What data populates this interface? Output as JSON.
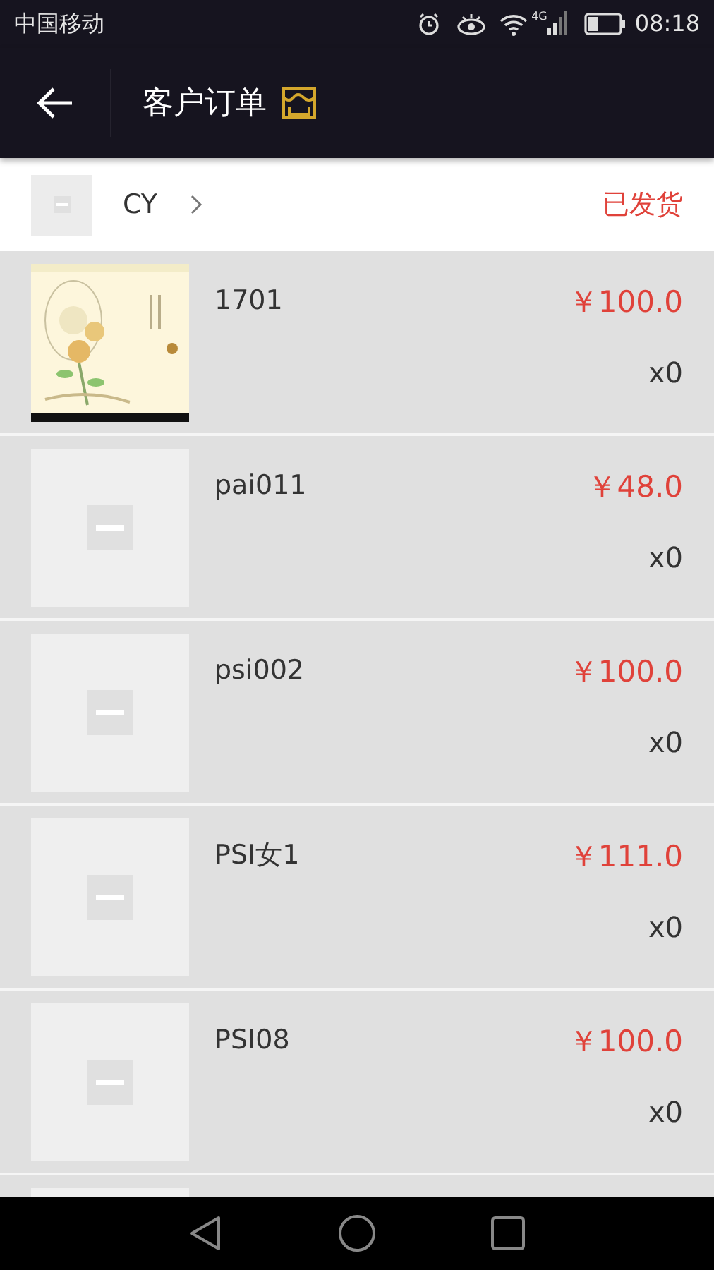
{
  "status_bar": {
    "carrier": "中国移动",
    "network": "4G",
    "time": "08:18"
  },
  "header": {
    "title": "客户订单"
  },
  "customer": {
    "name": "CY",
    "status": "已发货"
  },
  "items": [
    {
      "kind": "picture",
      "name": "1701",
      "price": "￥100.0",
      "quantity": "x0"
    },
    {
      "kind": "placeholder",
      "name": "pai011",
      "price": "￥48.0",
      "quantity": "x0"
    },
    {
      "kind": "placeholder",
      "name": "psi002",
      "price": "￥100.0",
      "quantity": "x0"
    },
    {
      "kind": "placeholder",
      "name": "PSI女1",
      "price": "￥111.0",
      "quantity": "x0"
    },
    {
      "kind": "placeholder",
      "name": "PSI08",
      "price": "￥100.0",
      "quantity": "x0"
    }
  ]
}
